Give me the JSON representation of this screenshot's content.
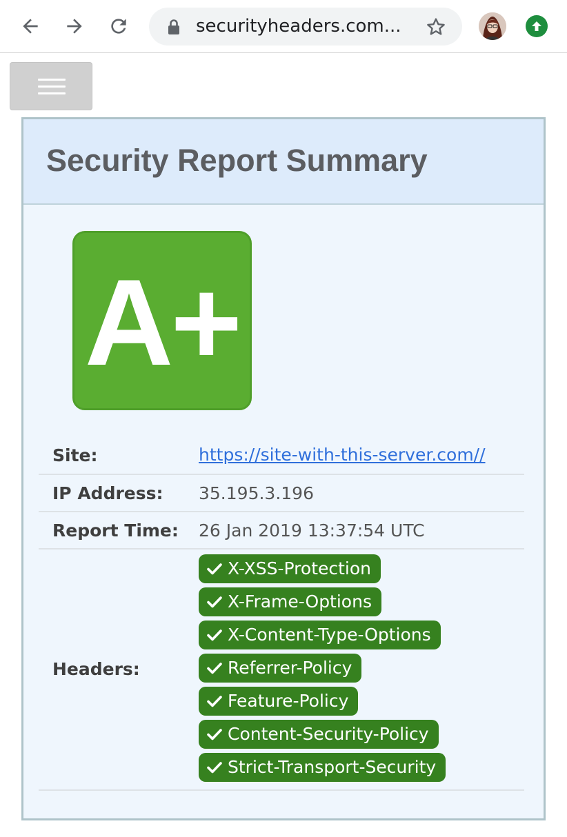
{
  "browser": {
    "url": "securityheaders.com...",
    "colors": {
      "omnibox": "#f1f3f4",
      "update": "#1e8e3e"
    }
  },
  "report": {
    "title": "Security Report Summary",
    "grade": "A+",
    "grade_color": "#5aad31",
    "site_label": "Site:",
    "site_value": "https://site-with-this-server.com//",
    "ip_label": "IP Address:",
    "ip_value": "35.195.3.196",
    "time_label": "Report Time:",
    "time_value": "26 Jan 2019 13:37:54 UTC",
    "headers_label": "Headers:",
    "headers": [
      "X-XSS-Protection",
      "X-Frame-Options",
      "X-Content-Type-Options",
      "Referrer-Policy",
      "Feature-Policy",
      "Content-Security-Policy",
      "Strict-Transport-Security"
    ],
    "pill_color": "#36811f"
  }
}
